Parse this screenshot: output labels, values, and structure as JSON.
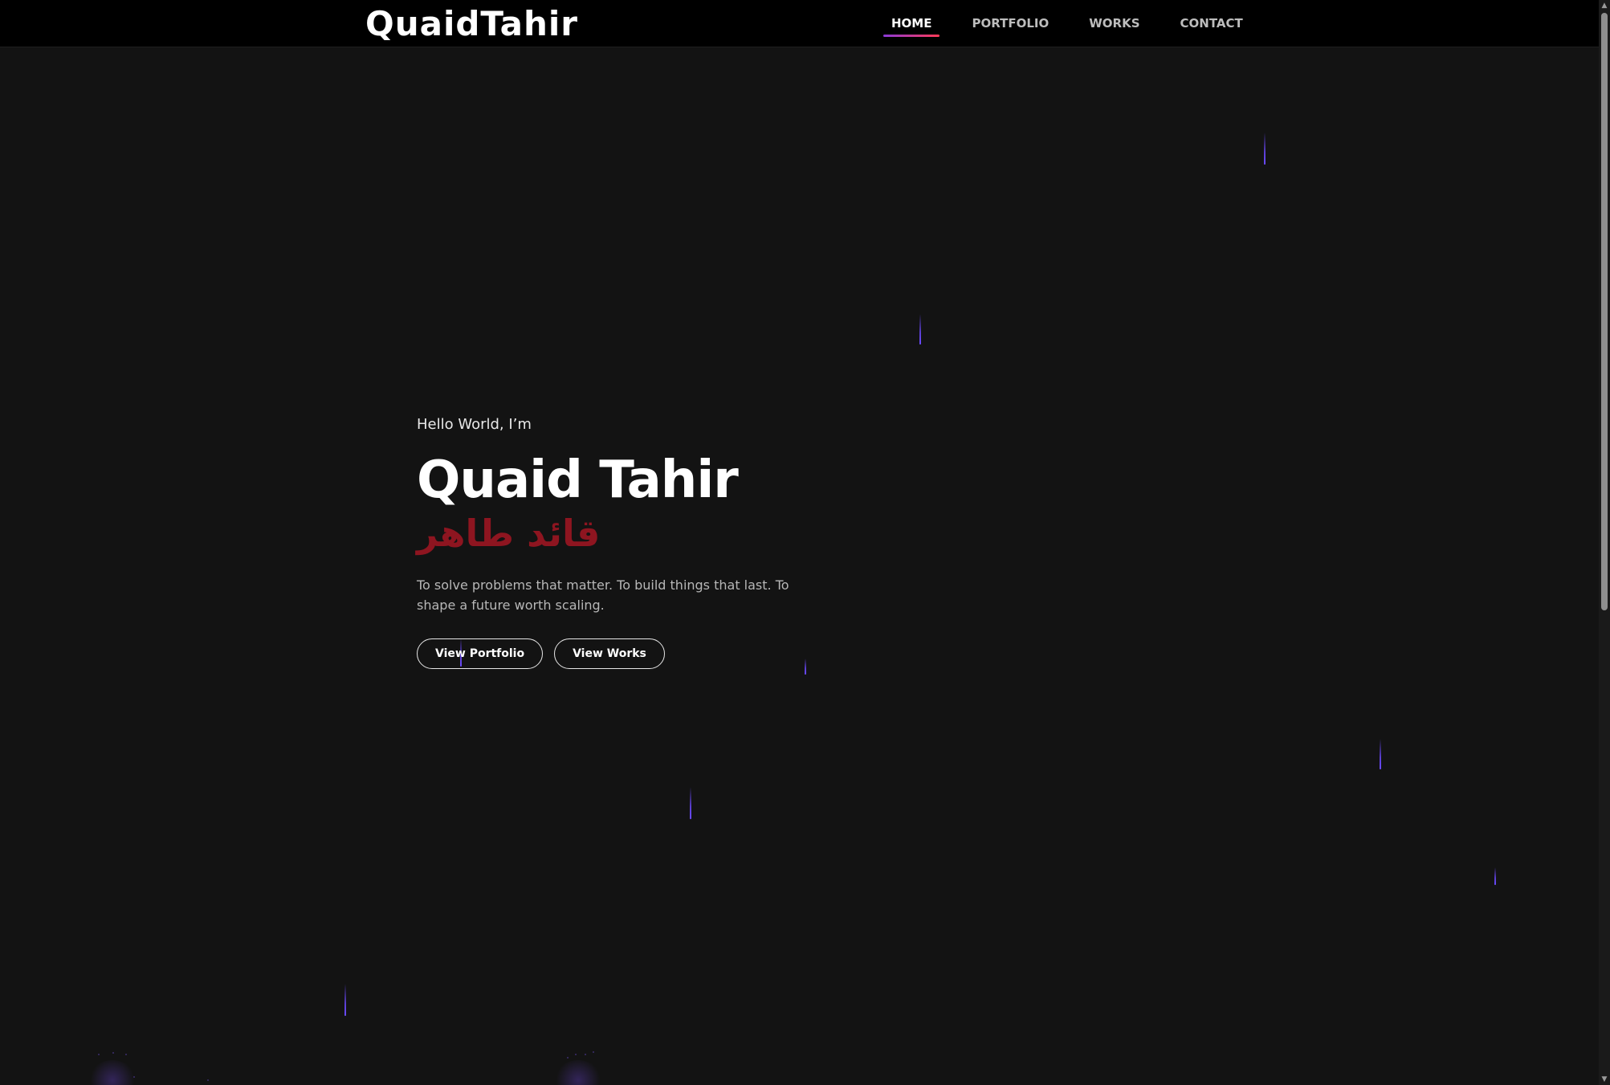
{
  "brand": {
    "name": "QuaidTahir"
  },
  "nav": {
    "items": [
      {
        "label": "HOME",
        "active": true
      },
      {
        "label": "PORTFOLIO",
        "active": false
      },
      {
        "label": "WORKS",
        "active": false
      },
      {
        "label": "CONTACT",
        "active": false
      }
    ]
  },
  "hero": {
    "greeting": "Hello World, I’m",
    "name": "Quaid Tahir",
    "arabic_name": "قائد طاهر",
    "tagline": "To solve problems that matter. To build things that last. To shape a future worth scaling.",
    "buttons": {
      "portfolio": "View Portfolio",
      "works": "View Works"
    }
  },
  "colors": {
    "background": "#131313",
    "header": "#000000",
    "accent_gradient_start": "#8a3ad6",
    "accent_gradient_end": "#ff3a56",
    "arabic_text": "#8e1520",
    "rain": "#5a3ecf"
  },
  "icons": {
    "scroll_up": "scroll-up-arrow-icon",
    "scroll_down": "scroll-down-arrow-icon"
  }
}
